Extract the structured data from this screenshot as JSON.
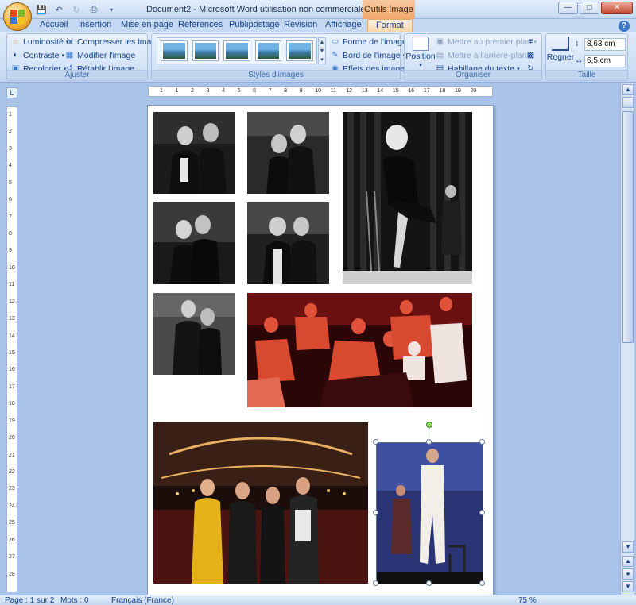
{
  "window": {
    "title": "Document2 - Microsoft Word utilisation non commerciale",
    "contextual_tab_group": "Outils Image"
  },
  "tabs": [
    "Accueil",
    "Insertion",
    "Mise en page",
    "Références",
    "Publipostage",
    "Révision",
    "Affichage",
    "Format"
  ],
  "active_tab": "Format",
  "ribbon": {
    "ajuster": {
      "label": "Ajuster",
      "luminosite": "Luminosité",
      "contraste": "Contraste",
      "recolorier": "Recolorier",
      "compresser": "Compresser les images",
      "modifier": "Modifier l'image",
      "retablir": "Rétablir l'image"
    },
    "styles": {
      "label": "Styles d'images",
      "forme": "Forme de l'image",
      "bord": "Bord de l'image",
      "effets": "Effets des images"
    },
    "organiser": {
      "label": "Organiser",
      "position": "Position",
      "premier_plan": "Mettre au premier plan",
      "arriere_plan": "Mettre à l'arrière-plan",
      "habillage": "Habillage du texte"
    },
    "taille": {
      "label": "Taille",
      "rogner": "Rogner",
      "height": "8,63 cm",
      "width": "6,5 cm"
    }
  },
  "ruler": {
    "h_numbers": [
      "1",
      "1",
      "2",
      "3",
      "4",
      "5",
      "6",
      "7",
      "8",
      "9",
      "10",
      "11",
      "12",
      "13",
      "14",
      "15",
      "16",
      "17",
      "18",
      "19",
      "20"
    ],
    "v_numbers": [
      "1",
      "2",
      "3",
      "4",
      "5",
      "6",
      "7",
      "8",
      "9",
      "10",
      "11",
      "12",
      "13",
      "14",
      "15",
      "16",
      "17",
      "18",
      "19",
      "20",
      "21",
      "22",
      "23",
      "24",
      "25",
      "26",
      "27",
      "28"
    ]
  },
  "status": {
    "page": "Page : 1 sur 2",
    "mots": "Mots : 0",
    "langue": "Français (France)",
    "zoom": "75 %"
  },
  "colors": {
    "ribbon_bg": "#cfe0f5",
    "format_tab": "#f8d6ad",
    "workspace": "#a9c4e8",
    "outils_image": "#f2a86b"
  }
}
